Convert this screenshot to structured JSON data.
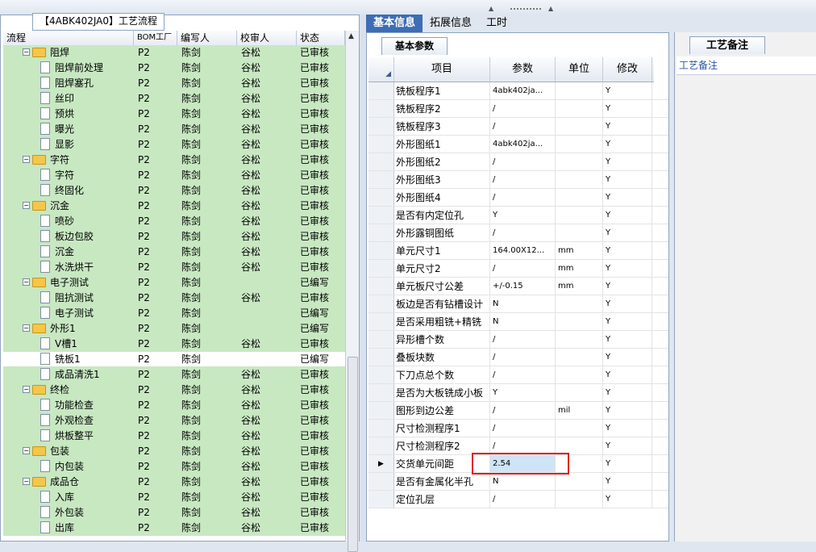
{
  "window": {
    "caption": "【4ABK402JA0】工艺流程"
  },
  "tree": {
    "headers": [
      "流程",
      "BOM工厂",
      "编写人",
      "校审人",
      "状态"
    ],
    "rows": [
      {
        "level": 1,
        "type": "folder",
        "name": "阻焊",
        "bom": "P2",
        "writer": "陈剑",
        "reviewer": "谷松",
        "status": "已审核"
      },
      {
        "level": 2,
        "type": "doc",
        "name": "阻焊前处理",
        "bom": "P2",
        "writer": "陈剑",
        "reviewer": "谷松",
        "status": "已审核"
      },
      {
        "level": 2,
        "type": "doc",
        "name": "阻焊塞孔",
        "bom": "P2",
        "writer": "陈剑",
        "reviewer": "谷松",
        "status": "已审核"
      },
      {
        "level": 2,
        "type": "doc",
        "name": "丝印",
        "bom": "P2",
        "writer": "陈剑",
        "reviewer": "谷松",
        "status": "已审核"
      },
      {
        "level": 2,
        "type": "doc",
        "name": "预烘",
        "bom": "P2",
        "writer": "陈剑",
        "reviewer": "谷松",
        "status": "已审核"
      },
      {
        "level": 2,
        "type": "doc",
        "name": "曝光",
        "bom": "P2",
        "writer": "陈剑",
        "reviewer": "谷松",
        "status": "已审核"
      },
      {
        "level": 2,
        "type": "doc",
        "name": "显影",
        "bom": "P2",
        "writer": "陈剑",
        "reviewer": "谷松",
        "status": "已审核"
      },
      {
        "level": 1,
        "type": "folder",
        "name": "字符",
        "bom": "P2",
        "writer": "陈剑",
        "reviewer": "谷松",
        "status": "已审核"
      },
      {
        "level": 2,
        "type": "doc",
        "name": "字符",
        "bom": "P2",
        "writer": "陈剑",
        "reviewer": "谷松",
        "status": "已审核"
      },
      {
        "level": 2,
        "type": "doc",
        "name": "终固化",
        "bom": "P2",
        "writer": "陈剑",
        "reviewer": "谷松",
        "status": "已审核"
      },
      {
        "level": 1,
        "type": "folder",
        "name": "沉金",
        "bom": "P2",
        "writer": "陈剑",
        "reviewer": "谷松",
        "status": "已审核"
      },
      {
        "level": 2,
        "type": "doc",
        "name": "喷砂",
        "bom": "P2",
        "writer": "陈剑",
        "reviewer": "谷松",
        "status": "已审核"
      },
      {
        "level": 2,
        "type": "doc",
        "name": "板边包胶",
        "bom": "P2",
        "writer": "陈剑",
        "reviewer": "谷松",
        "status": "已审核"
      },
      {
        "level": 2,
        "type": "doc",
        "name": "沉金",
        "bom": "P2",
        "writer": "陈剑",
        "reviewer": "谷松",
        "status": "已审核"
      },
      {
        "level": 2,
        "type": "doc",
        "name": "水洗烘干",
        "bom": "P2",
        "writer": "陈剑",
        "reviewer": "谷松",
        "status": "已审核"
      },
      {
        "level": 1,
        "type": "folder",
        "name": "电子测试",
        "bom": "P2",
        "writer": "陈剑",
        "reviewer": "",
        "status": "已编写"
      },
      {
        "level": 2,
        "type": "doc",
        "name": "阻抗测试",
        "bom": "P2",
        "writer": "陈剑",
        "reviewer": "谷松",
        "status": "已审核"
      },
      {
        "level": 2,
        "type": "doc",
        "name": "电子测试",
        "bom": "P2",
        "writer": "陈剑",
        "reviewer": "",
        "status": "已编写"
      },
      {
        "level": 1,
        "type": "folder",
        "name": "外形1",
        "bom": "P2",
        "writer": "陈剑",
        "reviewer": "",
        "status": "已编写"
      },
      {
        "level": 2,
        "type": "doc",
        "name": "V槽1",
        "bom": "P2",
        "writer": "陈剑",
        "reviewer": "谷松",
        "status": "已审核"
      },
      {
        "level": 2,
        "type": "doc",
        "name": "铣板1",
        "bom": "P2",
        "writer": "陈剑",
        "reviewer": "",
        "status": "已编写",
        "selected": true
      },
      {
        "level": 2,
        "type": "doc",
        "name": "成品清洗1",
        "bom": "P2",
        "writer": "陈剑",
        "reviewer": "谷松",
        "status": "已审核"
      },
      {
        "level": 1,
        "type": "folder",
        "name": "终检",
        "bom": "P2",
        "writer": "陈剑",
        "reviewer": "谷松",
        "status": "已审核"
      },
      {
        "level": 2,
        "type": "doc",
        "name": "功能检查",
        "bom": "P2",
        "writer": "陈剑",
        "reviewer": "谷松",
        "status": "已审核"
      },
      {
        "level": 2,
        "type": "doc",
        "name": "外观检查",
        "bom": "P2",
        "writer": "陈剑",
        "reviewer": "谷松",
        "status": "已审核"
      },
      {
        "level": 2,
        "type": "doc",
        "name": "烘板整平",
        "bom": "P2",
        "writer": "陈剑",
        "reviewer": "谷松",
        "status": "已审核"
      },
      {
        "level": 1,
        "type": "folder",
        "name": "包装",
        "bom": "P2",
        "writer": "陈剑",
        "reviewer": "谷松",
        "status": "已审核"
      },
      {
        "level": 2,
        "type": "doc",
        "name": "内包装",
        "bom": "P2",
        "writer": "陈剑",
        "reviewer": "谷松",
        "status": "已审核"
      },
      {
        "level": 1,
        "type": "folder",
        "name": "成品仓",
        "bom": "P2",
        "writer": "陈剑",
        "reviewer": "谷松",
        "status": "已审核"
      },
      {
        "level": 2,
        "type": "doc",
        "name": "入库",
        "bom": "P2",
        "writer": "陈剑",
        "reviewer": "谷松",
        "status": "已审核"
      },
      {
        "level": 2,
        "type": "doc",
        "name": "外包装",
        "bom": "P2",
        "writer": "陈剑",
        "reviewer": "谷松",
        "status": "已审核"
      },
      {
        "level": 2,
        "type": "doc",
        "name": "出库",
        "bom": "P2",
        "writer": "陈剑",
        "reviewer": "谷松",
        "status": "已审核"
      }
    ]
  },
  "tabs": [
    "基本信息",
    "拓展信息",
    "工时"
  ],
  "subtab": "基本参数",
  "grid": {
    "headers": [
      "项目",
      "参数",
      "单位",
      "修改"
    ],
    "rows": [
      {
        "item": "铣板程序1",
        "param": "4abk402ja...",
        "unit": "",
        "mod": "Y"
      },
      {
        "item": "铣板程序2",
        "param": "/",
        "unit": "",
        "mod": "Y"
      },
      {
        "item": "铣板程序3",
        "param": "/",
        "unit": "",
        "mod": "Y"
      },
      {
        "item": "外形图纸1",
        "param": "4abk402ja...",
        "unit": "",
        "mod": "Y"
      },
      {
        "item": "外形图纸2",
        "param": "/",
        "unit": "",
        "mod": "Y"
      },
      {
        "item": "外形图纸3",
        "param": "/",
        "unit": "",
        "mod": "Y"
      },
      {
        "item": "外形图纸4",
        "param": "/",
        "unit": "",
        "mod": "Y"
      },
      {
        "item": "是否有内定位孔",
        "param": "Y",
        "unit": "",
        "mod": "Y"
      },
      {
        "item": "外形露铜图纸",
        "param": "/",
        "unit": "",
        "mod": "Y"
      },
      {
        "item": "单元尺寸1",
        "param": "164.00X12...",
        "unit": "mm",
        "mod": "Y"
      },
      {
        "item": "单元尺寸2",
        "param": "/",
        "unit": "mm",
        "mod": "Y"
      },
      {
        "item": "单元板尺寸公差",
        "param": "+/-0.15",
        "unit": "mm",
        "mod": "Y"
      },
      {
        "item": "板边是否有钻槽设计",
        "param": "N",
        "unit": "",
        "mod": "Y"
      },
      {
        "item": "是否采用粗铣+精铣",
        "param": "N",
        "unit": "",
        "mod": "Y"
      },
      {
        "item": "异形槽个数",
        "param": "/",
        "unit": "",
        "mod": "Y"
      },
      {
        "item": "叠板块数",
        "param": "/",
        "unit": "",
        "mod": "Y"
      },
      {
        "item": "下刀点总个数",
        "param": "/",
        "unit": "",
        "mod": "Y"
      },
      {
        "item": "是否为大板铣成小板",
        "param": "Y",
        "unit": "",
        "mod": "Y"
      },
      {
        "item": "图形到边公差",
        "param": "/",
        "unit": "mil",
        "mod": "Y"
      },
      {
        "item": "尺寸检测程序1",
        "param": "/",
        "unit": "",
        "mod": "Y"
      },
      {
        "item": "尺寸检测程序2",
        "param": "/",
        "unit": "",
        "mod": "Y"
      },
      {
        "item": "交货单元间距",
        "param": "2.54",
        "unit": "",
        "mod": "Y",
        "current": true
      },
      {
        "item": "是否有金属化半孔",
        "param": "N",
        "unit": "",
        "mod": "Y"
      },
      {
        "item": "定位孔层",
        "param": "/",
        "unit": "",
        "mod": "Y"
      }
    ]
  },
  "notes": {
    "tab": "工艺备注",
    "header": "工艺备注"
  }
}
